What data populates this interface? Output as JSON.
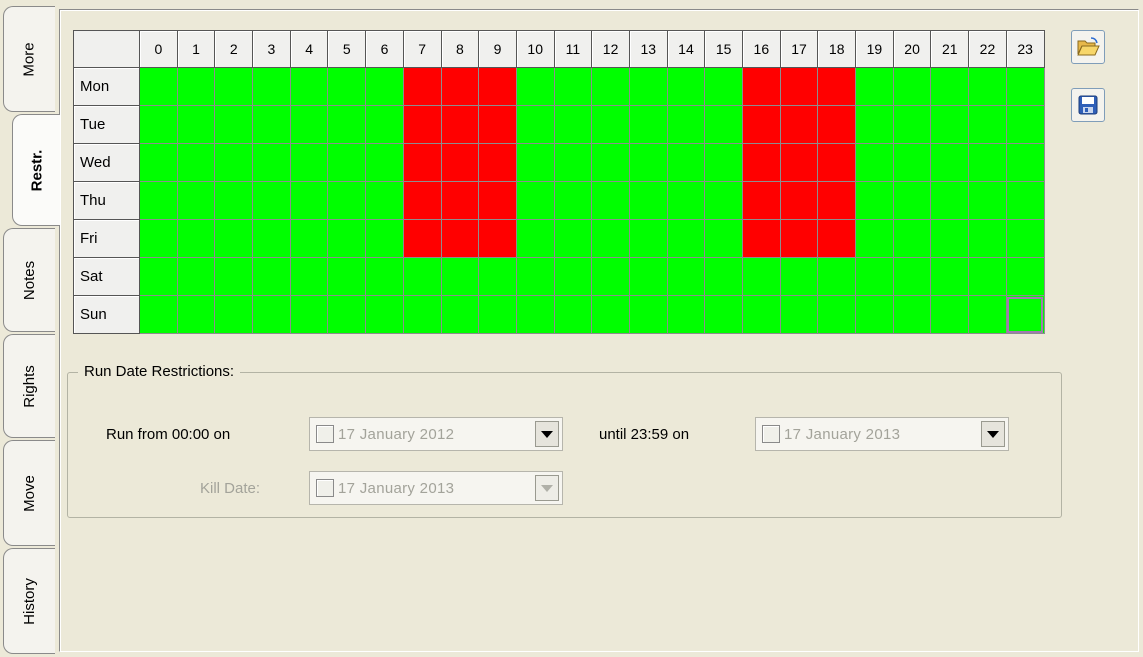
{
  "tabs": [
    {
      "label": "More",
      "active": false
    },
    {
      "label": "Restr.",
      "active": true
    },
    {
      "label": "Notes",
      "active": false
    },
    {
      "label": "Rights",
      "active": false
    },
    {
      "label": "Move",
      "active": false
    },
    {
      "label": "History",
      "active": false
    }
  ],
  "schedule": {
    "hours": [
      "0",
      "1",
      "2",
      "3",
      "4",
      "5",
      "6",
      "7",
      "8",
      "9",
      "10",
      "11",
      "12",
      "13",
      "14",
      "15",
      "16",
      "17",
      "18",
      "19",
      "20",
      "21",
      "22",
      "23"
    ],
    "days": [
      "Mon",
      "Tue",
      "Wed",
      "Thu",
      "Fri",
      "Sat",
      "Sun"
    ],
    "blocked_hours_weekdays": [
      7,
      8,
      9,
      16,
      17,
      18
    ],
    "blocked_days": [
      "Mon",
      "Tue",
      "Wed",
      "Thu",
      "Fri"
    ],
    "selected_cell": {
      "day": "Sun",
      "hour": 23
    },
    "colors": {
      "allowed": "#00ff00",
      "blocked": "#ff0000"
    }
  },
  "side_buttons": {
    "open_icon": "folder-open-icon",
    "save_icon": "floppy-disk-icon"
  },
  "run_dates": {
    "group_label": "Run Date Restrictions:",
    "from_label": "Run from 00:00 on",
    "from_value": "17   January   2012",
    "until_label": "until 23:59 on",
    "until_value": "17   January   2013",
    "kill_label": "Kill Date:",
    "kill_value": "17   January   2013"
  }
}
